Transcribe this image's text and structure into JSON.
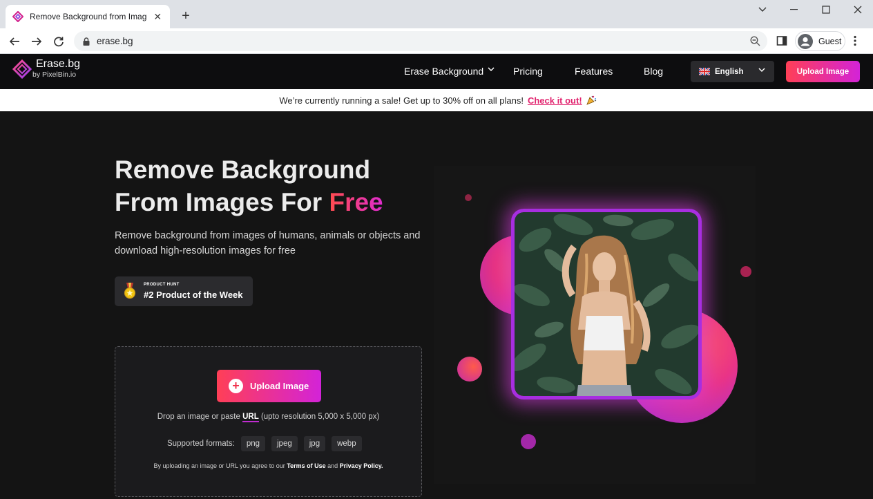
{
  "browser": {
    "tab_title": "Remove Background from Image",
    "url": "erase.bg",
    "profile_label": "Guest"
  },
  "header": {
    "logo_name": "Erase.bg",
    "logo_sub": "by PixelBin.io",
    "nav": [
      "Erase Background",
      "Pricing",
      "Features",
      "Blog"
    ],
    "language": "English",
    "upload_label": "Upload Image"
  },
  "banner": {
    "text": "We’re currently running a sale! Get up to 30% off on all plans!",
    "link": "Check it out!"
  },
  "hero": {
    "title_line1": "Remove Background",
    "title_line2": "From Images For",
    "title_highlight": "Free",
    "subtitle": "Remove background from images of humans, animals or objects and download high-resolution images for free"
  },
  "product_hunt": {
    "kicker": "PRODUCT HUNT",
    "text": "#2 Product of the Week"
  },
  "upload": {
    "button_label": "Upload Image",
    "drop_prefix": "Drop an image or paste",
    "drop_url": "URL",
    "drop_suffix": "(upto resolution 5,000 x 5,000 px)",
    "formats_label": "Supported formats:",
    "formats": [
      "png",
      "jpeg",
      "jpg",
      "webp"
    ],
    "terms_prefix": "By uploading an image or URL you agree to our",
    "terms_link": "Terms of Use",
    "terms_and": "and",
    "privacy_link": "Privacy Policy."
  },
  "colors": {
    "accent_start": "#ff3f56",
    "accent_end": "#d323d8",
    "background": "#141414"
  }
}
